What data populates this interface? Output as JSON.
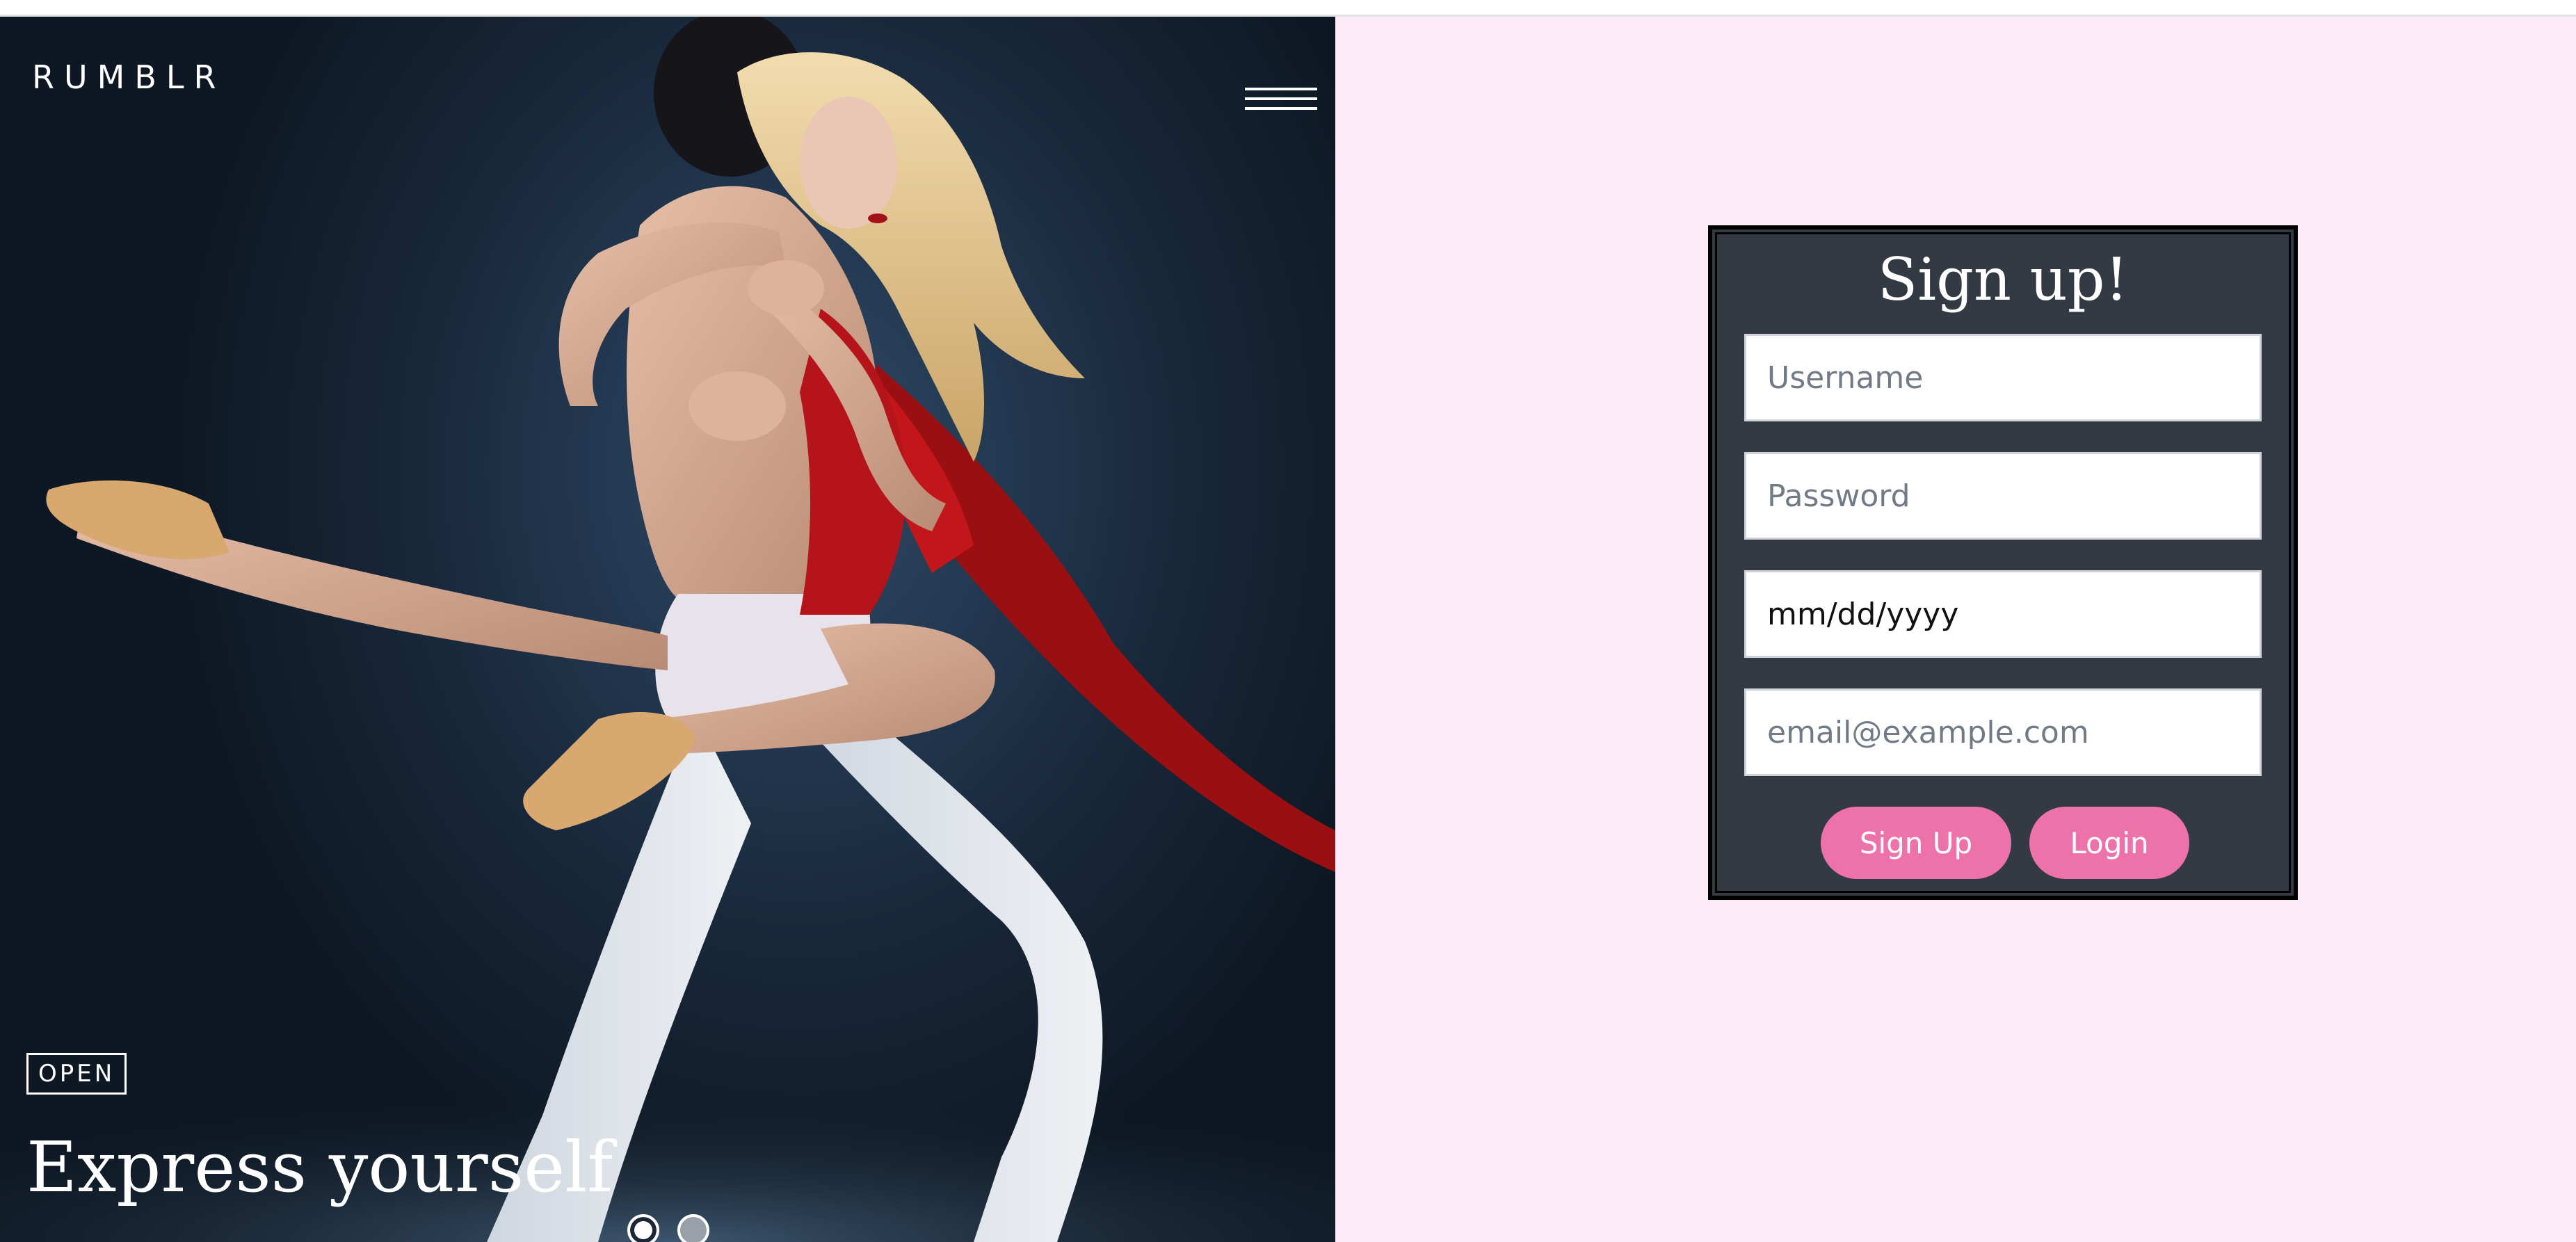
{
  "brand": {
    "logo": "RUMBLR"
  },
  "hero": {
    "badge": "OPEN",
    "title": "Express yourself",
    "slides": [
      {
        "active": true
      },
      {
        "active": false
      }
    ]
  },
  "signup": {
    "title": "Sign up!",
    "username_placeholder": "Username",
    "password_placeholder": "Password",
    "date_placeholder": "mm/dd/yyyy",
    "email_placeholder": "email@example.com",
    "signup_label": "Sign Up",
    "login_label": "Login"
  },
  "colors": {
    "page_bg": "#fcecf8",
    "card_bg": "#343a44",
    "button_pink": "#ee72aa"
  },
  "icons": {
    "menu": "hamburger-icon"
  }
}
